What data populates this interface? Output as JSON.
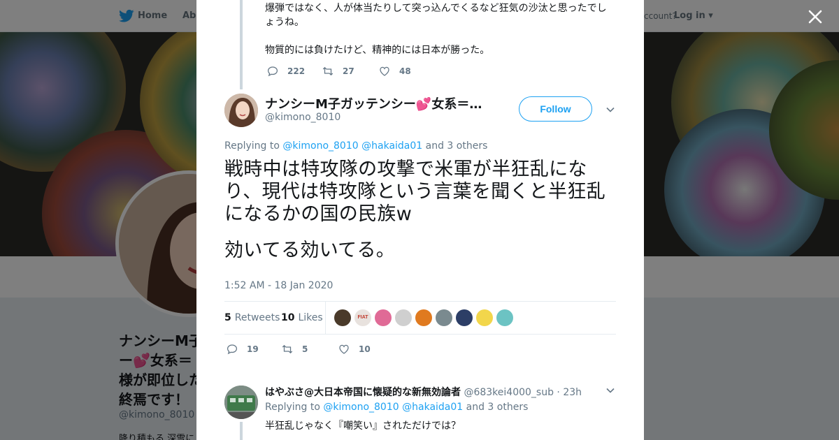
{
  "topbar": {
    "home_label": "Home",
    "about_label": "Abo",
    "have_account_text": "ccount?",
    "login_label": "Log in"
  },
  "background_profile": {
    "name_lines": [
      "ナンシーM子",
      "ー💕女系＝",
      "様が即位した",
      "終焉です！"
    ],
    "handle": "@kimono_8010",
    "bio_snippet": "降り積もる 深雪に"
  },
  "previous_tweet": {
    "text_lines": [
      "爆弾ではなく、人が体当たりして突っ込んでくるなど狂気の沙汰と思ったでし",
      "ょうね。"
    ],
    "text2": "物質的には負けたけど、精神的には日本が勝った。",
    "replies": "222",
    "retweets": "27",
    "likes": "48"
  },
  "main_tweet": {
    "fullname": "ナンシーM子ガッテンシー💕女系＝…",
    "handle": "@kimono_8010",
    "follow_label": "Follow",
    "replying_prefix": "Replying to",
    "replying_user1": "@kimono_8010",
    "replying_user2": "@hakaida01",
    "replying_suffix": "and 3 others",
    "text_lines": [
      "戦時中は特攻隊の攻撃で米軍が半狂乱にな",
      "り、現代は特攻隊という言葉を聞くと半狂乱",
      "になるかの国の民族w"
    ],
    "text_last": "効いてる効いてる。",
    "timestamp": "1:52 AM - 18 Jan 2020",
    "retweets_count": "5",
    "retweets_label": "Retweets",
    "likes_count": "10",
    "likes_label": "Likes",
    "reply_count": "19",
    "retweet_count": "5",
    "like_count": "10",
    "liker_colors": [
      "#4a3a2a",
      "#e8e2de",
      "#e06a96",
      "#cfcfcf",
      "#e07a1f",
      "#7a8a8f",
      "#2c3e66",
      "#f2d64b",
      "#6cc3c3"
    ],
    "liker_badge_text": "FIAT"
  },
  "reply_tweet": {
    "name": "はやぶさ@大日本帝国に懐疑的な新無効論者",
    "handle": "@683kei4000_sub",
    "time": "· 23h",
    "replying_prefix": "Replying to",
    "replying_user1": "@kimono_8010",
    "replying_user2": "@hakaida01",
    "replying_suffix": "and 3 others",
    "text": "半狂乱じゃなく『嘲笑い』されただけでは？"
  },
  "colors": {
    "accent": "#1da1f2",
    "secondary_text": "#657786",
    "thread_line": "#ccd6dd",
    "overlay": "rgba(0,0,0,0.5)"
  },
  "icons": [
    "twitter-bird-icon",
    "close-icon",
    "reply-icon",
    "retweet-icon",
    "like-icon",
    "chevron-down-icon"
  ]
}
